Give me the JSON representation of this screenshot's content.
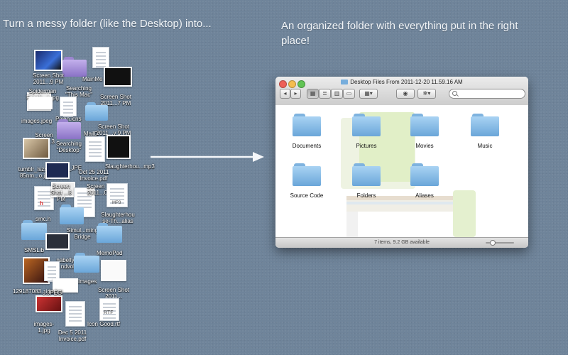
{
  "captions": {
    "left": "Turn a messy folder (like the Desktop) into...",
    "right": "An organized folder with everything put in the right place!"
  },
  "messy_labels": {
    "l1": "Screen Shot 2011...9 PM",
    "l2": "MainMe",
    "l3": "Spiderman Faceb...s.jpg",
    "l4": "Searching \"This Mac\"",
    "l5": "Screen Shot 2011...7 PM",
    "l6": "images.jpeg",
    "l7": "Pixen.icns",
    "l8": "MailD",
    "l9": "Screen Shot 2011...y 9 PM",
    "l10": "Screen Shot ...3 PM",
    "l11": "Searching \"Desktop\"",
    "l12": "tumblr_lszxzs 85nm...o.jpg",
    "l13": "_JPE",
    "l14": "Oct 25 2011 Invoice.pdf",
    "l15": "Slaughterhou...mp3",
    "l16": "Screen Shot ...8 PM",
    "l17": "Screen Shot 2011...0 PM",
    "l18": "smc.h",
    "l19": "Slaughterhou se-Th...alias",
    "l20": "Simul...ming Bridge",
    "l21": "SMSLib",
    "l22": "MemoPad",
    "l23": "nabelly ...ndvol",
    "l24": "Images",
    "l25": "129187083...ide.jpg",
    "l26": "Screen Shot 2011...",
    "l27": "images-1.jpg",
    "l28": "Icon Good.rtf",
    "l29": "Dec 5 2011 Invoice.pdf",
    "l30": "J.JPEG",
    "l31": "RTF",
    "l32": "MP3",
    "l33": "h"
  },
  "window": {
    "title": "Desktop Files From 2011-12-20 11.59.16 AM",
    "status": "7 items, 9.2 GB available",
    "items": [
      {
        "name": "Documents"
      },
      {
        "name": "Pictures"
      },
      {
        "name": "Movies"
      },
      {
        "name": "Music"
      },
      {
        "name": "Source Code"
      },
      {
        "name": "Folders"
      },
      {
        "name": "Aliases"
      }
    ]
  },
  "colors": {
    "background": "#6f849a",
    "folder_blue": "#8fc2ea",
    "close": "#ee5f57",
    "minimize": "#f5bd4f",
    "zoom": "#61c454"
  },
  "icons": [
    "back-icon",
    "forward-icon",
    "icon-view-icon",
    "list-view-icon",
    "column-view-icon",
    "coverflow-view-icon",
    "arrange-icon",
    "quicklook-eye-icon",
    "gear-icon",
    "search-icon",
    "folder-icon",
    "arrow-right-icon"
  ]
}
